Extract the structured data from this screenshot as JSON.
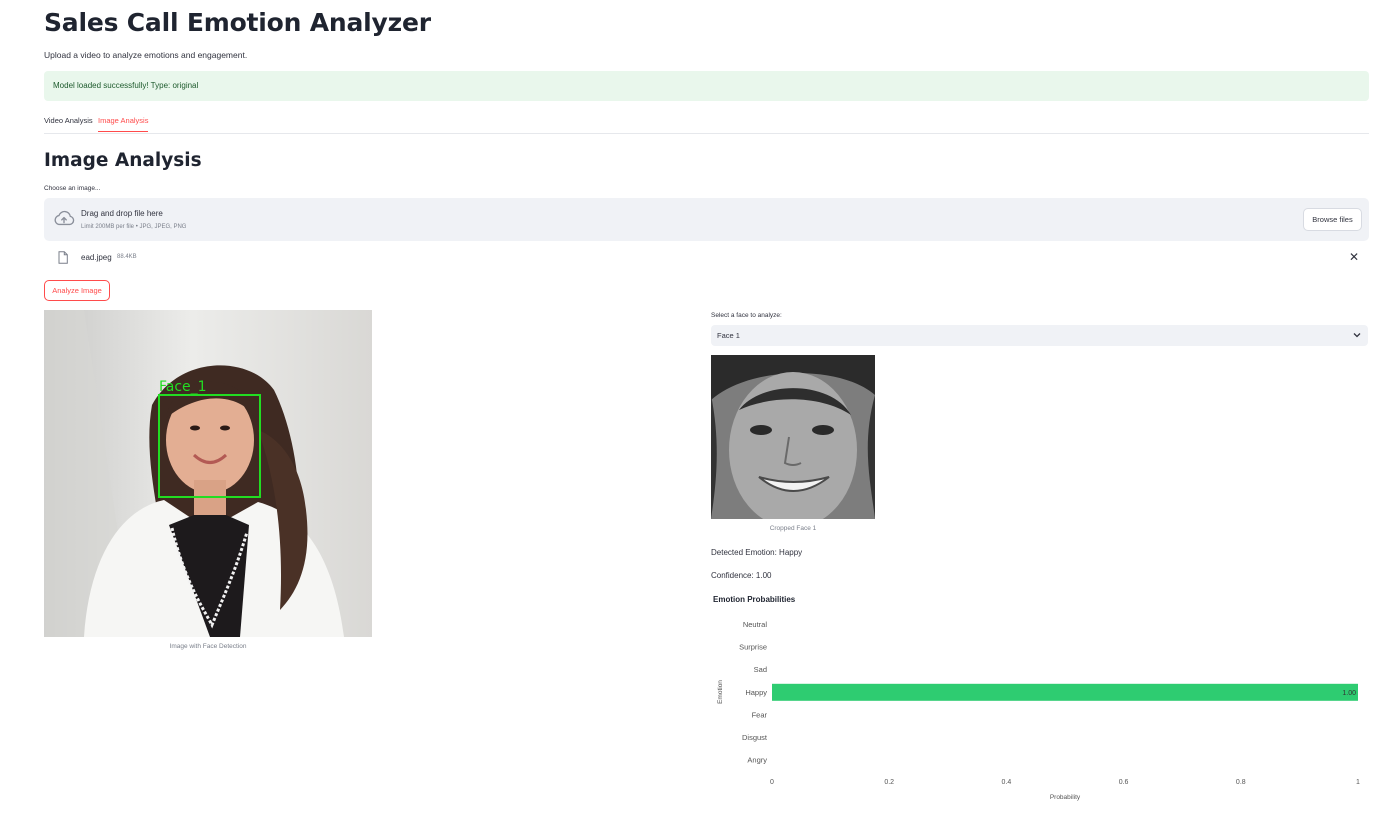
{
  "app": {
    "title": "Sales Call Emotion Analyzer",
    "subtitle": "Upload a video to analyze emotions and engagement.",
    "alert": "Model loaded successfully! Type: original",
    "alert_color": "#e9f7ec",
    "accent_color": "#ff4b4b"
  },
  "tabs": [
    {
      "label": "Video Analysis",
      "active": false
    },
    {
      "label": "Image Analysis",
      "active": true
    }
  ],
  "section": {
    "title": "Image Analysis",
    "uploader_label": "Choose an image..."
  },
  "uploader": {
    "icon": "cloud-upload-icon",
    "title": "Drag and drop file here",
    "limit": "Limit 200MB per file • JPG, JPEG, PNG",
    "browse_label": "Browse files"
  },
  "file": {
    "icon": "file-icon",
    "name": "ead.jpeg",
    "size": "88.4KB",
    "close_icon": "close-icon"
  },
  "analyze_button": "Analyze Image",
  "left_image": {
    "face_label": "Face_1",
    "caption": "Image with Face Detection",
    "box_color": "#22dd22"
  },
  "face_select": {
    "label": "Select a face to analyze:",
    "value": "Face 1"
  },
  "cropped": {
    "caption": "Cropped Face 1"
  },
  "result": {
    "detected": "Detected Emotion: Happy",
    "confidence": "Confidence: 1.00"
  },
  "chart_data": {
    "type": "bar",
    "orientation": "horizontal",
    "title": "Emotion Probabilities",
    "xlabel": "Probability",
    "ylabel": "Emotion",
    "categories": [
      "Neutral",
      "Surprise",
      "Sad",
      "Happy",
      "Fear",
      "Disgust",
      "Angry"
    ],
    "values": [
      0,
      0,
      0,
      1.0,
      0,
      0,
      0
    ],
    "data_labels": [
      "",
      "",
      "",
      "1.00",
      "",
      "",
      ""
    ],
    "xlim": [
      0,
      1
    ],
    "xticks": [
      "0",
      "0.2",
      "0.4",
      "0.6",
      "0.8",
      "1"
    ],
    "bar_color": "#2ecc71",
    "grid": false
  }
}
